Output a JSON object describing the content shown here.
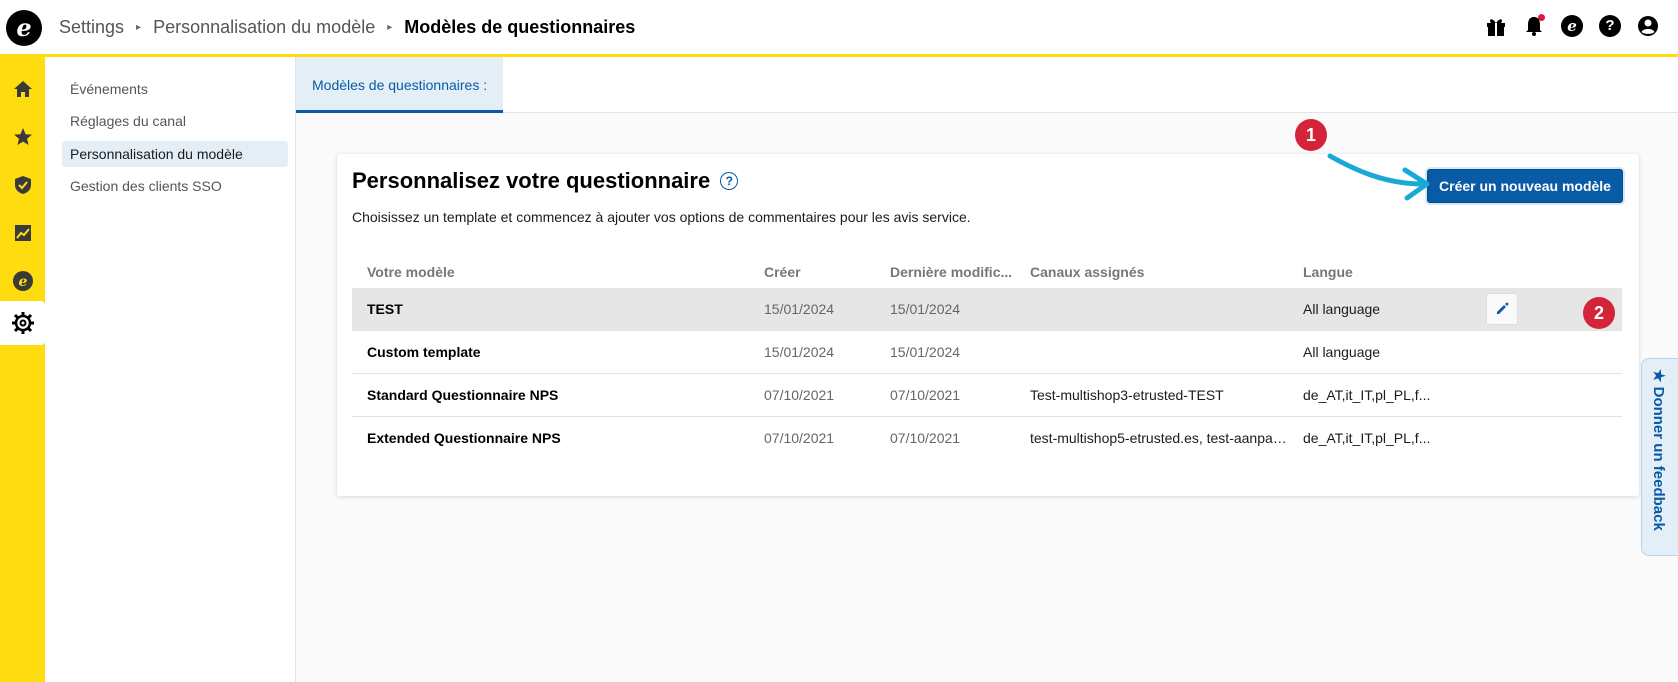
{
  "logo": {
    "letter": "e"
  },
  "breadcrumb": {
    "items": [
      "Settings",
      "Personnalisation du modèle"
    ],
    "current": "Modèles de questionnaires",
    "separator": "▸"
  },
  "topbar": {
    "icons": [
      "gift-icon",
      "bell-icon",
      "etrusted-icon",
      "help-icon",
      "account-icon"
    ],
    "etrusted_glyph": "e",
    "help_glyph": "?"
  },
  "rail": {
    "items": [
      "home-icon",
      "star-icon",
      "shield-icon",
      "chart-icon",
      "etrusted-icon",
      "gear-icon"
    ],
    "active": "gear-icon"
  },
  "subnav": {
    "items": [
      {
        "label": "Événements"
      },
      {
        "label": "Réglages du canal"
      },
      {
        "label": "Personnalisation du modèle"
      },
      {
        "label": "Gestion des clients SSO"
      }
    ],
    "active_index": 2
  },
  "tabs": [
    {
      "label": "Modèles de questionnaires :"
    }
  ],
  "card": {
    "title": "Personnalisez votre questionnaire",
    "help_glyph": "?",
    "subtitle": "Choisissez un template et commencez à ajouter vos options de commentaires pour les avis service.",
    "create_button": "Créer un nouveau modèle",
    "annotations": [
      "1",
      "2"
    ]
  },
  "table": {
    "columns": [
      "Votre modèle",
      "Créer",
      "Dernière modific...",
      "Canaux assignés",
      "Langue"
    ],
    "rows": [
      {
        "name": "TEST",
        "created": "15/01/2024",
        "modified": "15/01/2024",
        "channels": "",
        "language": "All language"
      },
      {
        "name": "Custom template",
        "created": "15/01/2024",
        "modified": "15/01/2024",
        "channels": "",
        "language": "All language"
      },
      {
        "name": "Standard Questionnaire NPS",
        "created": "07/10/2021",
        "modified": "07/10/2021",
        "channels": "Test-multishop3-etrusted-TEST",
        "language": "de_AT,it_IT,pl_PL,f..."
      },
      {
        "name": "Extended Questionnaire NPS",
        "created": "07/10/2021",
        "modified": "07/10/2021",
        "channels": "test-multishop5-etrusted.es, test-aanpas...",
        "language": "de_AT,it_IT,pl_PL,f..."
      }
    ]
  },
  "feedback": {
    "label": "★ Donner un feedback"
  },
  "colors": {
    "brand_yellow": "#ffdc0f",
    "primary_blue": "#0a5ba6",
    "annotation_red": "#d3243a",
    "arrow_cyan": "#1aa8d6"
  }
}
